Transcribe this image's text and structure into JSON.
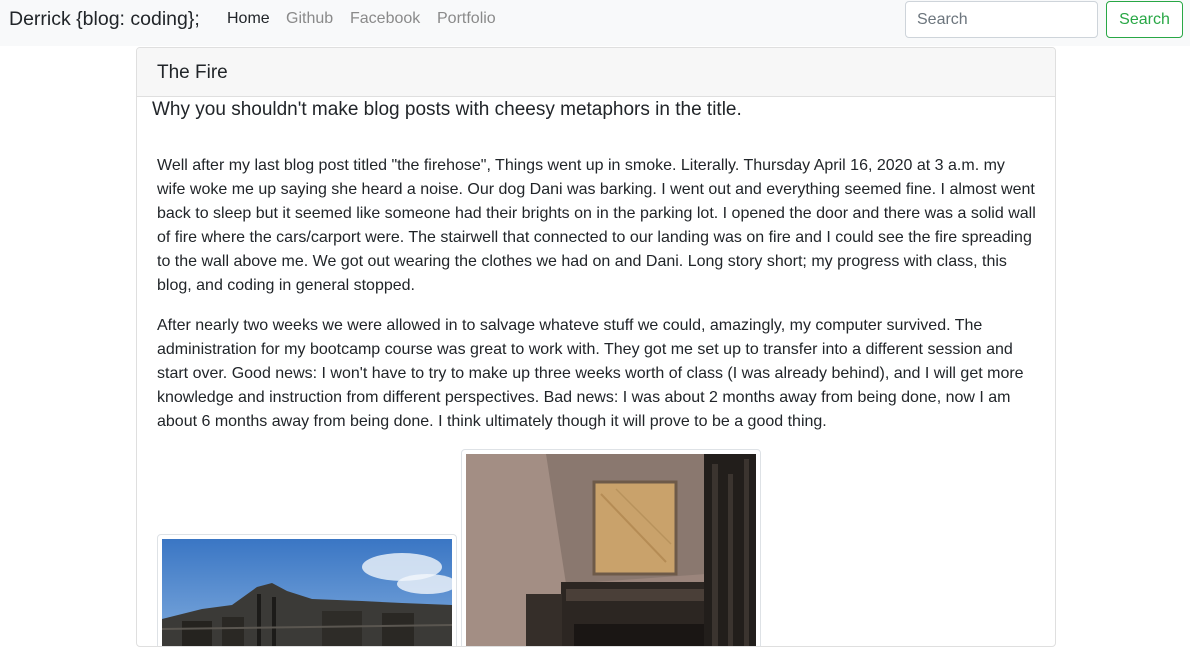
{
  "navbar": {
    "brand": "Derrick {blog: coding};",
    "links": [
      {
        "label": "Home",
        "active": true
      },
      {
        "label": "Github",
        "active": false
      },
      {
        "label": "Facebook",
        "active": false
      },
      {
        "label": "Portfolio",
        "active": false
      }
    ],
    "search": {
      "placeholder": "Search",
      "value": ""
    },
    "search_button_label": "Search"
  },
  "post": {
    "title": "The Fire",
    "subtitle": "Why you shouldn't make blog posts with cheesy metaphors in the title.",
    "paragraphs": [
      "Well after my last blog post titled \"the firehose\", Things went up in smoke. Literally. Thursday April 16, 2020 at 3 a.m. my wife woke me up saying she heard a noise. Our dog Dani was barking. I went out and everything seemed fine. I almost went back to sleep but it seemed like someone had their brights on in the parking lot. I opened the door and there was a solid wall of fire where the cars/carport were. The stairwell that connected to our landing was on fire and I could see the fire spreading to the wall above me. We got out wearing the clothes we had on and Dani. Long story short; my progress with class, this blog, and coding in general stopped.",
      "After nearly two weeks we were allowed in to salvage whateve stuff we could, amazingly, my computer survived. The administration for my bootcamp course was great to work with. They got me set up to transfer into a different session and start over. Good news: I won't have to try to make up three weeks worth of class (I was already behind), and I will get more knowledge and instruction from different perspectives. Bad news: I was about 2 months away from being done, now I am about 6 months away from being done. I think ultimately though it will prove to be a good thing."
    ]
  },
  "colors": {
    "success": "#28a745",
    "navbar_bg": "#f8f9fa",
    "card_header_bg": "#f7f7f7"
  }
}
